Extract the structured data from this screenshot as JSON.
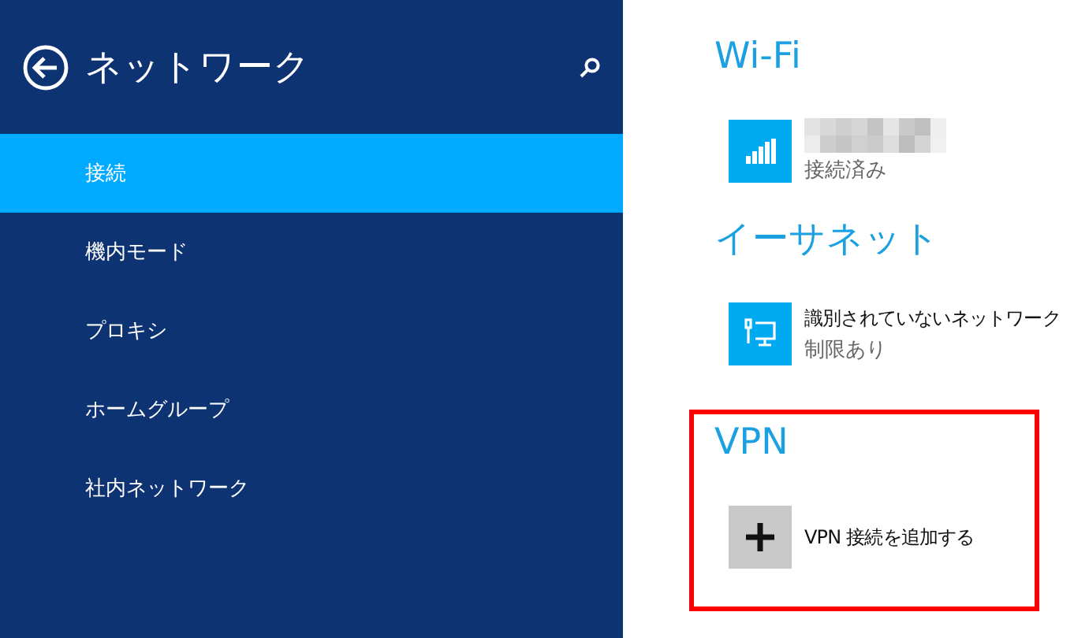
{
  "header": {
    "title": "ネットワーク"
  },
  "nav": [
    {
      "label": "接続",
      "selected": true
    },
    {
      "label": "機内モード",
      "selected": false
    },
    {
      "label": "プロキシ",
      "selected": false
    },
    {
      "label": "ホームグループ",
      "selected": false
    },
    {
      "label": "社内ネットワーク",
      "selected": false
    }
  ],
  "sections": [
    {
      "heading": "Wi-Fi",
      "highlighted": false,
      "items": [
        {
          "kind": "wifi",
          "status": "接続済み"
        }
      ]
    },
    {
      "heading": "イーサネット",
      "highlighted": false,
      "items": [
        {
          "kind": "ethernet",
          "name": "識別されていないネットワーク",
          "status": "制限あり"
        }
      ]
    },
    {
      "heading": "VPN",
      "highlighted": true,
      "items": [
        {
          "kind": "add",
          "name": "VPN 接続を追加する"
        }
      ]
    }
  ]
}
